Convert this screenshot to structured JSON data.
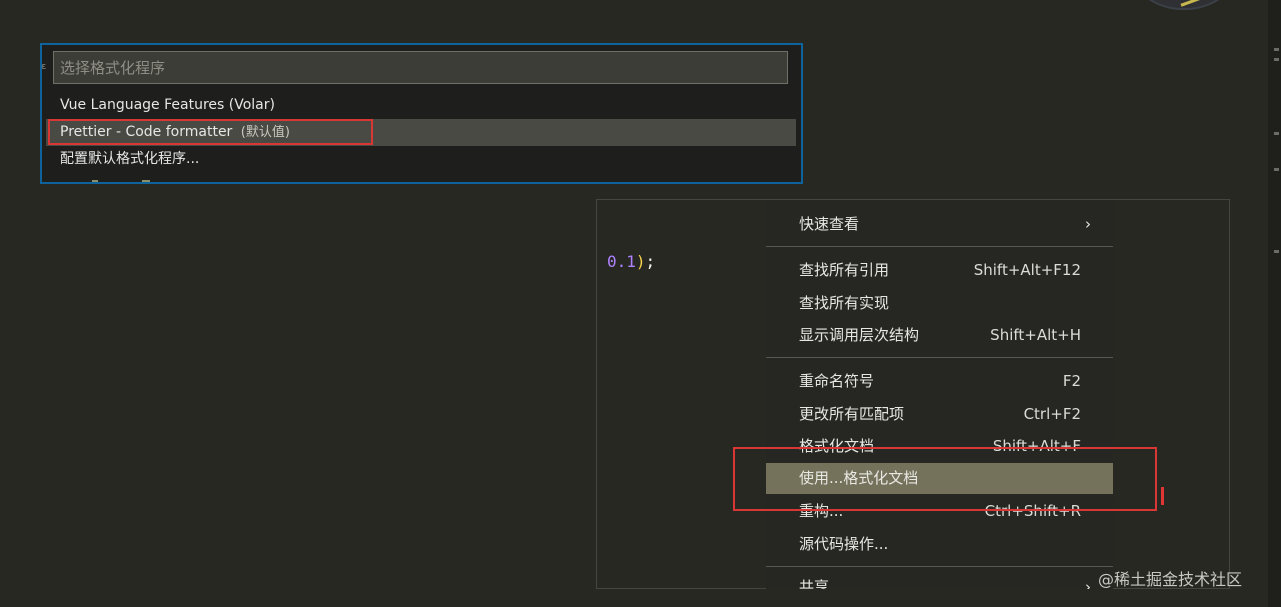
{
  "formatter_picker": {
    "placeholder": "选择格式化程序",
    "items": [
      {
        "label": "Vue Language Features (Volar)",
        "description": ""
      },
      {
        "label": "Prettier - Code formatter",
        "description": "(默认值)"
      },
      {
        "label": "配置默认格式化程序...",
        "description": ""
      }
    ]
  },
  "editor": {
    "code_number": "0.1",
    "code_paren": ")",
    "code_semicolon": ";"
  },
  "context_menu": {
    "items": [
      {
        "label": "快速查看",
        "shortcut": "",
        "has_submenu": true
      },
      {
        "label": "查找所有引用",
        "shortcut": "Shift+Alt+F12"
      },
      {
        "label": "查找所有实现",
        "shortcut": ""
      },
      {
        "label": "显示调用层次结构",
        "shortcut": "Shift+Alt+H"
      },
      {
        "label": "重命名符号",
        "shortcut": "F2"
      },
      {
        "label": "更改所有匹配项",
        "shortcut": "Ctrl+F2"
      },
      {
        "label": "格式化文档",
        "shortcut": "Shift+Alt+F"
      },
      {
        "label": "使用...格式化文档",
        "shortcut": "",
        "active": true
      },
      {
        "label": "重构...",
        "shortcut": "Ctrl+Shift+R"
      },
      {
        "label": "源代码操作...",
        "shortcut": ""
      },
      {
        "label": "共享",
        "shortcut": "",
        "has_submenu": true
      }
    ],
    "submenu_chevron": "›"
  },
  "watermark": "@稀土掘金技术社区",
  "colors": {
    "background": "#272822",
    "focus_border": "#0e639c",
    "annotation_red": "#d93636",
    "menu_active": "#75725c"
  }
}
